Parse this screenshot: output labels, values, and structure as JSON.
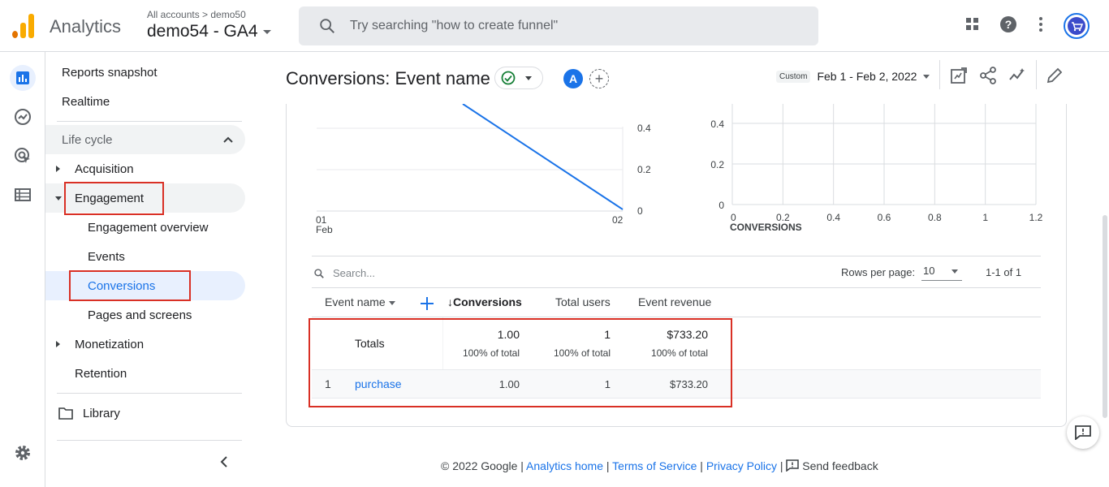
{
  "app": {
    "name": "Analytics"
  },
  "account": {
    "breadcrumb": "All accounts > demo50",
    "property": "demo54 - GA4"
  },
  "search": {
    "placeholder": "Try searching \"how to create funnel\""
  },
  "nav": {
    "reports_snapshot": "Reports snapshot",
    "realtime": "Realtime",
    "lifecycle": "Life cycle",
    "acquisition": "Acquisition",
    "engagement": "Engagement",
    "engagement_overview": "Engagement overview",
    "events": "Events",
    "conversions": "Conversions",
    "pages_screens": "Pages and screens",
    "monetization": "Monetization",
    "retention": "Retention",
    "library": "Library"
  },
  "header": {
    "title": "Conversions: Event name",
    "avatar_letter": "A",
    "date_custom": "Custom",
    "date_range": "Feb 1 - Feb 2, 2022"
  },
  "chart_data": [
    {
      "type": "line",
      "x": [
        "01 Feb",
        "02"
      ],
      "series": [
        {
          "values": [
            0.6,
            0
          ]
        }
      ],
      "y_ticks": [
        "0.4",
        "0.2",
        "0"
      ],
      "x_tick_labels": [
        "01",
        "Feb",
        "02"
      ],
      "line_color": "#1a73e8"
    },
    {
      "type": "scatter",
      "xlabel": "CONVERSIONS",
      "x_ticks": [
        "0",
        "0.2",
        "0.4",
        "0.6",
        "0.8",
        "1",
        "1.2"
      ],
      "y_ticks": [
        "0.4",
        "0.2",
        "0"
      ],
      "grid": true
    }
  ],
  "table": {
    "search_placeholder": "Search...",
    "rows_per_page_label": "Rows per page:",
    "rows_per_page": "10",
    "pagination": "1-1 of 1",
    "columns": [
      "Event name",
      "Conversions",
      "Total users",
      "Event revenue"
    ],
    "totals": {
      "label": "Totals",
      "conversions": "1.00",
      "conversions_pct": "100% of total",
      "users": "1",
      "users_pct": "100% of total",
      "revenue": "$733.20",
      "revenue_pct": "100% of total"
    },
    "rows": [
      {
        "index": "1",
        "event_name": "purchase",
        "conversions": "1.00",
        "users": "1",
        "revenue": "$733.20"
      }
    ]
  },
  "footer": {
    "copyright": "© 2022 Google |",
    "analytics_home": "Analytics home",
    "sep1": "|",
    "terms": "Terms of Service",
    "sep2": "|",
    "privacy": "Privacy Policy",
    "sep3": "|",
    "feedback": "Send feedback"
  },
  "colors": {
    "accent": "#1a73e8",
    "highlight_box": "#d93025",
    "selected_bg": "#e8f0fe",
    "logo": "#f9ab00"
  }
}
